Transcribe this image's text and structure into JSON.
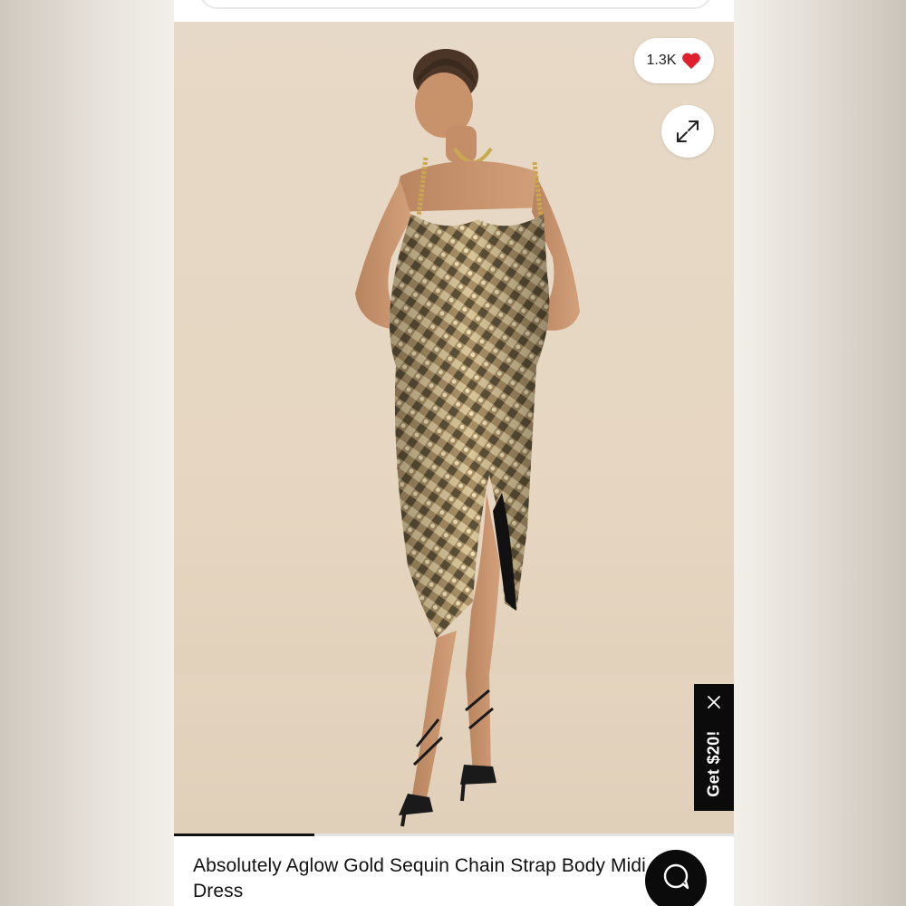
{
  "product": {
    "title": "Absolutely Aglow Gold Sequin Chain Strap Body Midi Dress",
    "image_alt": "Model wearing gold sequin chain strap midi dress with black strappy heels",
    "image_count_visible_fraction": 0.25
  },
  "likes": {
    "count": "1.3K",
    "icon": "heart-icon",
    "icon_color": "#e0202e"
  },
  "expand": {
    "icon": "expand-arrows-icon"
  },
  "promo": {
    "label": "Get $20!",
    "close_icon": "close-icon"
  },
  "chat": {
    "icon": "chat-bubble-icon"
  },
  "colors": {
    "accent": "#0b0b0b",
    "photo_background": "#e6d6c1",
    "dress_gold": "#b79e72"
  }
}
